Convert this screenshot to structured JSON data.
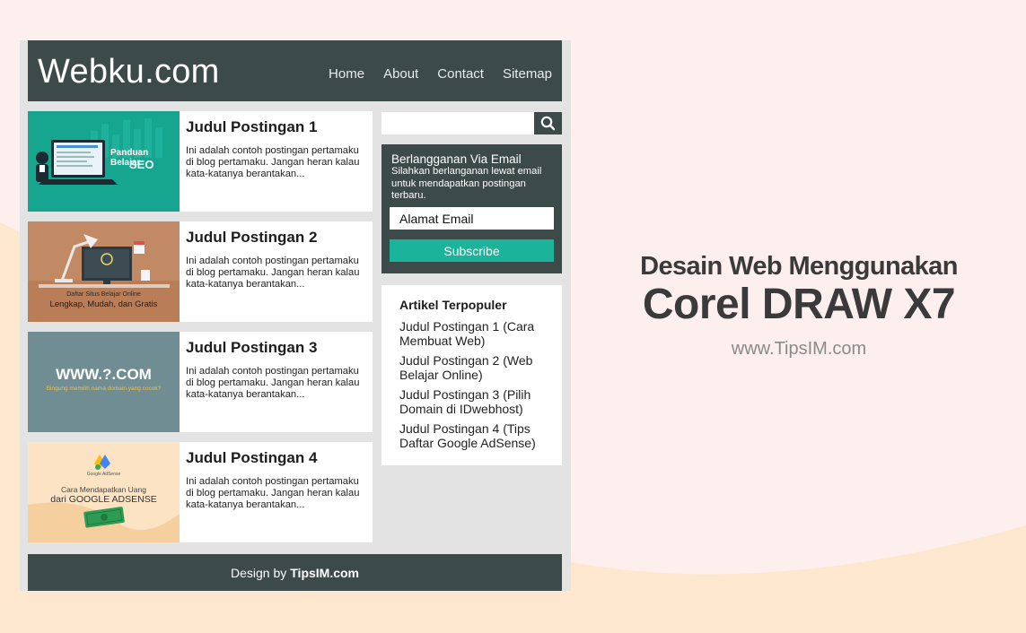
{
  "site": {
    "logo": "Webku.com"
  },
  "nav": [
    {
      "label": "Home"
    },
    {
      "label": "About"
    },
    {
      "label": "Contact"
    },
    {
      "label": "Sitemap"
    }
  ],
  "posts": [
    {
      "title": "Judul Postingan 1",
      "excerpt": "Ini adalah contoh postingan pertamaku di blog pertamaku. Jangan heran kalau kata-katanya berantakan...",
      "thumb": {
        "line1": "Panduan Belajar",
        "line2": "SEO",
        "bg": "#16a58f"
      }
    },
    {
      "title": "Judul Postingan 2",
      "excerpt": "Ini adalah contoh postingan pertamaku di blog pertamaku. Jangan heran kalau kata-katanya berantakan...",
      "thumb": {
        "line1": "Daftar Situs Belajar Online",
        "line2": "Lengkap, Mudah, dan Gratis",
        "bg": "#c28a64"
      }
    },
    {
      "title": "Judul Postingan 3",
      "excerpt": "Ini adalah contoh postingan pertamaku di blog pertamaku. Jangan heran kalau kata-katanya berantakan...",
      "thumb": {
        "line1": "WWW.?.COM",
        "line2": "Bingung memilih nama domain yang cocok?",
        "bg": "#6f8d92"
      }
    },
    {
      "title": "Judul Postingan 4",
      "excerpt": "Ini adalah contoh postingan pertamaku di blog pertamaku. Jangan heran kalau kata-katanya berantakan...",
      "thumb": {
        "brand": "Google AdSense",
        "line1": "Cara Mendapatkan Uang",
        "line2": "dari GOOGLE ADSENSE",
        "bg": "#fbe3c4"
      }
    }
  ],
  "search": {
    "placeholder": ""
  },
  "subscribe": {
    "title": "Berlangganan Via Email",
    "description": "Silahkan berlanganan lewat email untuk mendapatkan postingan terbaru.",
    "email_placeholder": "Alamat Email",
    "button_label": "Subscribe"
  },
  "popular": {
    "title": "Artikel Terpopuler",
    "items": [
      {
        "label": "Judul Postingan 1 (Cara Membuat Web)"
      },
      {
        "label": "Judul Postingan 2 (Web Belajar Online)"
      },
      {
        "label": "Judul Postingan 3 (Pilih Domain di IDwebhost)"
      },
      {
        "label": "Judul Postingan 4 (Tips Daftar Google AdSense)"
      }
    ]
  },
  "footer": {
    "prefix": "Design by",
    "brand": "TipsIM.com"
  },
  "hero": {
    "line1": "Desain Web Menggunakan",
    "line2": "Corel DRAW X7",
    "site": "www.TipsIM.com"
  },
  "colors": {
    "header": "#3c4a49",
    "accent": "#1bb39a",
    "background": "#fcefed",
    "peach": "#fde7cf"
  }
}
